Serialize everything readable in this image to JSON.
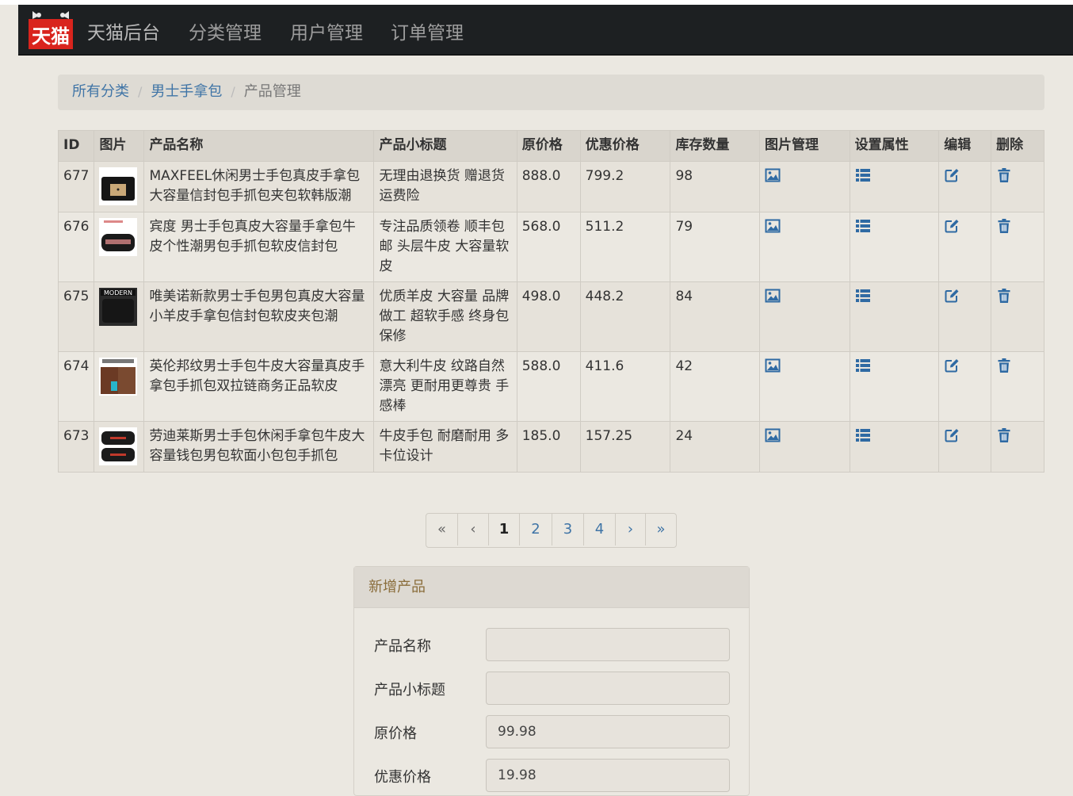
{
  "nav": {
    "logo_text": "天猫",
    "brand": "天猫后台",
    "items": [
      "分类管理",
      "用户管理",
      "订单管理"
    ]
  },
  "breadcrumb": {
    "items": [
      "所有分类",
      "男士手拿包"
    ],
    "current": "产品管理"
  },
  "table": {
    "headers": [
      "ID",
      "图片",
      "产品名称",
      "产品小标题",
      "原价格",
      "优惠价格",
      "库存数量",
      "图片管理",
      "设置属性",
      "编辑",
      "删除"
    ],
    "rows": [
      {
        "id": "677",
        "name": "MAXFEEL休闲男士手包真皮手拿包大容量信封包手抓包夹包软韩版潮",
        "subtitle": "无理由退换货 赠退货运费险",
        "price": "888.0",
        "promo": "799.2",
        "stock": "98"
      },
      {
        "id": "676",
        "name": "宾度 男士手包真皮大容量手拿包牛皮个性潮男包手抓包软皮信封包",
        "subtitle": "专注品质领卷 顺丰包邮 头层牛皮 大容量软皮",
        "price": "568.0",
        "promo": "511.2",
        "stock": "79"
      },
      {
        "id": "675",
        "name": "唯美诺新款男士手包男包真皮大容量小羊皮手拿包信封包软皮夹包潮",
        "subtitle": "优质羊皮 大容量 品牌做工 超软手感 终身包保修",
        "price": "498.0",
        "promo": "448.2",
        "stock": "84"
      },
      {
        "id": "674",
        "name": "英伦邦纹男士手包牛皮大容量真皮手拿包手抓包双拉链商务正品软皮",
        "subtitle": "意大利牛皮 纹路自然漂亮 更耐用更尊贵 手感棒",
        "price": "588.0",
        "promo": "411.6",
        "stock": "42"
      },
      {
        "id": "673",
        "name": "劳迪莱斯男士手包休闲手拿包牛皮大容量钱包男包软面小包包手抓包",
        "subtitle": "牛皮手包 耐磨耐用 多卡位设计",
        "price": "185.0",
        "promo": "157.25",
        "stock": "24"
      }
    ]
  },
  "pagination": {
    "first": "«",
    "prev": "‹",
    "pages": [
      "1",
      "2",
      "3",
      "4"
    ],
    "current": "1",
    "next": "›",
    "last": "»"
  },
  "form": {
    "title": "新增产品",
    "fields": [
      {
        "label": "产品名称",
        "value": ""
      },
      {
        "label": "产品小标题",
        "value": ""
      },
      {
        "label": "原价格",
        "value": "99.98"
      },
      {
        "label": "优惠价格",
        "value": "19.98"
      }
    ]
  },
  "colors": {
    "navbar": "#1d2022",
    "link": "#3f74a6",
    "panel_title": "#8a6d3b",
    "logo_red": "#d9241d"
  }
}
